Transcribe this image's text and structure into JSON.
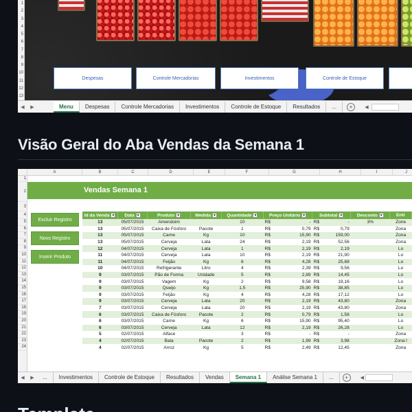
{
  "top_screenshot": {
    "row_numbers": [
      "1",
      "2",
      "3",
      "4",
      "5",
      "6",
      "7",
      "8",
      "9",
      "10",
      "11",
      "12",
      "13"
    ],
    "nav_buttons": [
      "Despesas",
      "Controle Mercadorias",
      "Investimentos",
      "Controle de Estoque"
    ],
    "tabs": [
      "Menu",
      "Despesas",
      "Controle Mercadorias",
      "Investimentos",
      "Controle de Estoque",
      "Resultados",
      "..."
    ],
    "active_tab": "Menu"
  },
  "section_heading": "Visão Geral do Aba Vendas da Semana 1",
  "sheet": {
    "columns": [
      "A",
      "B",
      "C",
      "D",
      "E",
      "F",
      "G",
      "H",
      "I",
      "J"
    ],
    "row_numbers": [
      "1",
      "2",
      "3",
      "4",
      "5",
      "6",
      "7",
      "8",
      "9",
      "10",
      "11",
      "12",
      "13",
      "14",
      "15",
      "16",
      "17",
      "18",
      "19",
      "20",
      "21",
      "22",
      "23",
      "24"
    ],
    "title": "Vendas Semana 1",
    "side_buttons": [
      "Excluir Registro",
      "Novo Registro",
      "Inserir Produto"
    ],
    "headers": [
      "Id da Venda",
      "Data",
      "Produto",
      "Medida",
      "Quantidade",
      "Preço Unitário",
      "Subtotal",
      "Desconto",
      "Entr"
    ],
    "rows": [
      [
        "13",
        "05/07/2015",
        "Amendoim",
        "",
        "10",
        "R$",
        "-",
        "R$",
        "-",
        "3%",
        "Zone"
      ],
      [
        "13",
        "05/07/2015",
        "Caixa de Fósforo",
        "Pacote",
        "1",
        "R$",
        "0,79",
        "R$",
        "0,79",
        "",
        "Zona"
      ],
      [
        "13",
        "05/07/2015",
        "Carne",
        "Kg",
        "10",
        "R$",
        "15,90",
        "R$",
        "159,00",
        "",
        "Zona"
      ],
      [
        "13",
        "05/07/2015",
        "Cerveja",
        "Lata",
        "24",
        "R$",
        "2,19",
        "R$",
        "52,56",
        "",
        "Zona"
      ],
      [
        "12",
        "04/07/2015",
        "Cerveja",
        "Lata",
        "1",
        "R$",
        "2,19",
        "R$",
        "2,19",
        "",
        "Lo"
      ],
      [
        "11",
        "04/07/2015",
        "Cerveja",
        "Lata",
        "10",
        "R$",
        "2,19",
        "R$",
        "21,90",
        "",
        "Lo"
      ],
      [
        "11",
        "04/07/2015",
        "Feijão",
        "Kg",
        "6",
        "R$",
        "4,28",
        "R$",
        "25,68",
        "",
        "Lo"
      ],
      [
        "10",
        "04/07/2015",
        "Refrigerante",
        "Litro",
        "4",
        "R$",
        "2,39",
        "R$",
        "9,56",
        "",
        "Lo"
      ],
      [
        "9",
        "03/07/2015",
        "Pão de Forma",
        "Unidade",
        "5",
        "R$",
        "2,89",
        "R$",
        "14,45",
        "",
        "Lo"
      ],
      [
        "9",
        "03/07/2015",
        "Vagem",
        "Kg",
        "2",
        "R$",
        "9,58",
        "R$",
        "19,16",
        "",
        "Lo"
      ],
      [
        "9",
        "03/07/2015",
        "Queijo",
        "Kg",
        "1,5",
        "R$",
        "25,90",
        "R$",
        "38,85",
        "",
        "Lo"
      ],
      [
        "9",
        "03/07/2015",
        "Feijão",
        "Kg",
        "4",
        "R$",
        "4,28",
        "R$",
        "17,12",
        "",
        "Lo"
      ],
      [
        "9",
        "03/07/2015",
        "Cerveja",
        "Lata",
        "20",
        "R$",
        "2,19",
        "R$",
        "43,80",
        "",
        "Zona"
      ],
      [
        "7",
        "03/07/2015",
        "Cerveja",
        "Lata",
        "20",
        "R$",
        "2,19",
        "R$",
        "43,80",
        "",
        "Zona"
      ],
      [
        "6",
        "03/07/2015",
        "Caixa de Fósforo",
        "Pacote",
        "2",
        "R$",
        "0,79",
        "R$",
        "1,58",
        "",
        "Lo"
      ],
      [
        "6",
        "03/07/2015",
        "Carne",
        "Kg",
        "6",
        "R$",
        "15,90",
        "R$",
        "95,40",
        "",
        "Lo"
      ],
      [
        "6",
        "03/07/2015",
        "Cerveja",
        "Lata",
        "12",
        "R$",
        "2,19",
        "R$",
        "26,28",
        "",
        "Lo"
      ],
      [
        "5",
        "02/07/2015",
        "Alface",
        "",
        "3",
        "R$",
        "-",
        "R$",
        "-",
        "",
        "Zona"
      ],
      [
        "4",
        "02/07/2015",
        "Bala",
        "Pacote",
        "2",
        "R$",
        "1,99",
        "R$",
        "3,98",
        "",
        "Zona l"
      ],
      [
        "4",
        "02/07/2015",
        "Arroz",
        "Kg",
        "5",
        "R$",
        "2,49",
        "R$",
        "12,45",
        "",
        "Zona"
      ]
    ],
    "tabs": [
      "...",
      "Investimentos",
      "Controle de Estoque",
      "Resultados",
      "Vendas",
      "Semana 1",
      "Análise Semana 1",
      "..."
    ],
    "active_tab": "Semana 1"
  },
  "next_heading": "Template"
}
